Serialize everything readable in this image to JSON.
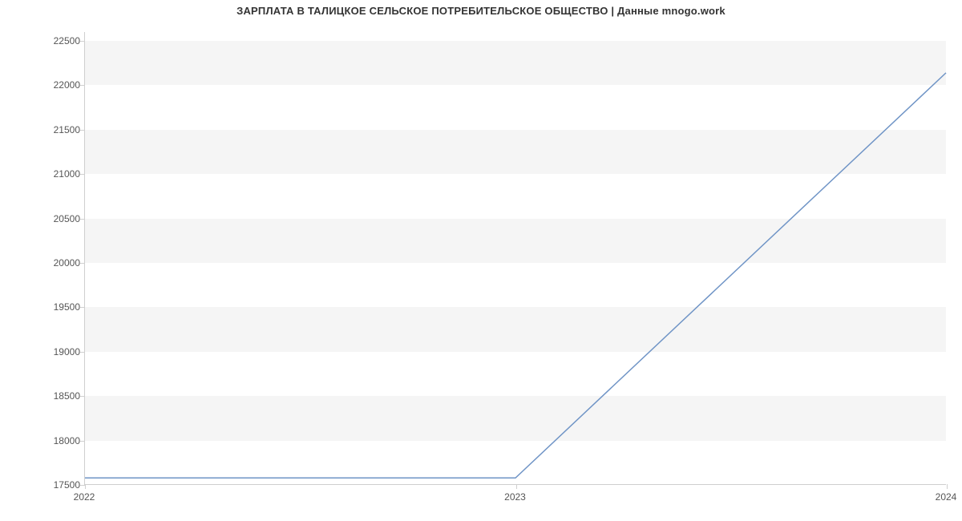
{
  "chart_data": {
    "type": "line",
    "title": "ЗАРПЛАТА В ТАЛИЦКОЕ СЕЛЬСКОЕ ПОТРЕБИТЕЛЬСКОЕ ОБЩЕСТВО | Данные mnogo.work",
    "x": [
      2022,
      2023,
      2024
    ],
    "values": [
      17570,
      17570,
      22140
    ],
    "x_tick_labels": [
      "2022",
      "2023",
      "2024"
    ],
    "y_tick_labels": [
      "17500",
      "18000",
      "18500",
      "19000",
      "19500",
      "20000",
      "20500",
      "21000",
      "21500",
      "22000",
      "22500"
    ],
    "y_ticks": [
      17500,
      18000,
      18500,
      19000,
      19500,
      20000,
      20500,
      21000,
      21500,
      22000,
      22500
    ],
    "xlabel": "",
    "ylabel": "",
    "xlim": [
      2022,
      2024
    ],
    "ylim": [
      17500,
      22600
    ],
    "grid": "banded",
    "line_color": "#6f94c6"
  }
}
